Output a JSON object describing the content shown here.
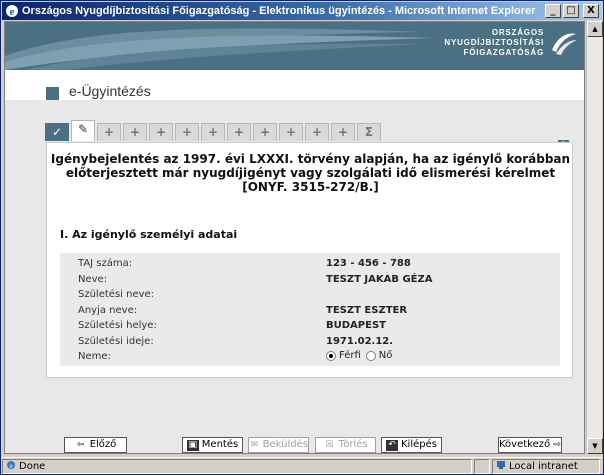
{
  "window": {
    "title": "Országos Nyugdíjbiztosítási Főigazgatóság - Elektronikus ügyintézés - Microsoft Internet Explorer",
    "minimize": "_",
    "maximize": "□",
    "close": "X"
  },
  "header": {
    "org_line1": "ORSZÁGOS",
    "org_line2": "NYUGDÍJBIZTOSÍTÁSI",
    "org_line3": "FŐIGAZGATÓSÁG",
    "page_title": "e-Ügyintézés"
  },
  "tabs": [
    "✓",
    "✎",
    "+",
    "+",
    "+",
    "+",
    "+",
    "+",
    "+",
    "+",
    "+",
    "+",
    "Σ"
  ],
  "help": "?",
  "form": {
    "heading_line1": "Igénybejelentés az 1997. évi LXXXI. törvény alapján, ha az igénylő korábban",
    "heading_line2": "előterjesztett már nyugdíjigényt vagy szolgálati idő elismerési kérelmet",
    "heading_line3": "[ONYF. 3515-272/B.]",
    "section_title": "I. Az igénylő személyi adatai",
    "rows": [
      {
        "label": "TAJ száma:",
        "value": "123 - 456 - 788"
      },
      {
        "label": "Neve:",
        "value": "TESZT JAKAB GÉZA"
      },
      {
        "label": "Születési neve:",
        "value": ""
      },
      {
        "label": "Anyja neve:",
        "value": "TESZT ESZTER"
      },
      {
        "label": "Születési helye:",
        "value": "BUDAPEST"
      },
      {
        "label": "Születési ideje:",
        "value": "1971.02.12."
      }
    ],
    "gender_label": "Neme:",
    "gender_options": [
      "Férfi",
      "Nő"
    ],
    "gender_selected": "Férfi"
  },
  "buttons": {
    "prev": "Előző",
    "save": "Mentés",
    "submit": "Beküldés",
    "delete": "Törlés",
    "exit": "Kilépés",
    "next": "Következő"
  },
  "statusbar": {
    "status": "Done",
    "zone": "Local intranet"
  },
  "colors": {
    "brand": "#4b6f83",
    "title_bar": "#0a246a"
  }
}
